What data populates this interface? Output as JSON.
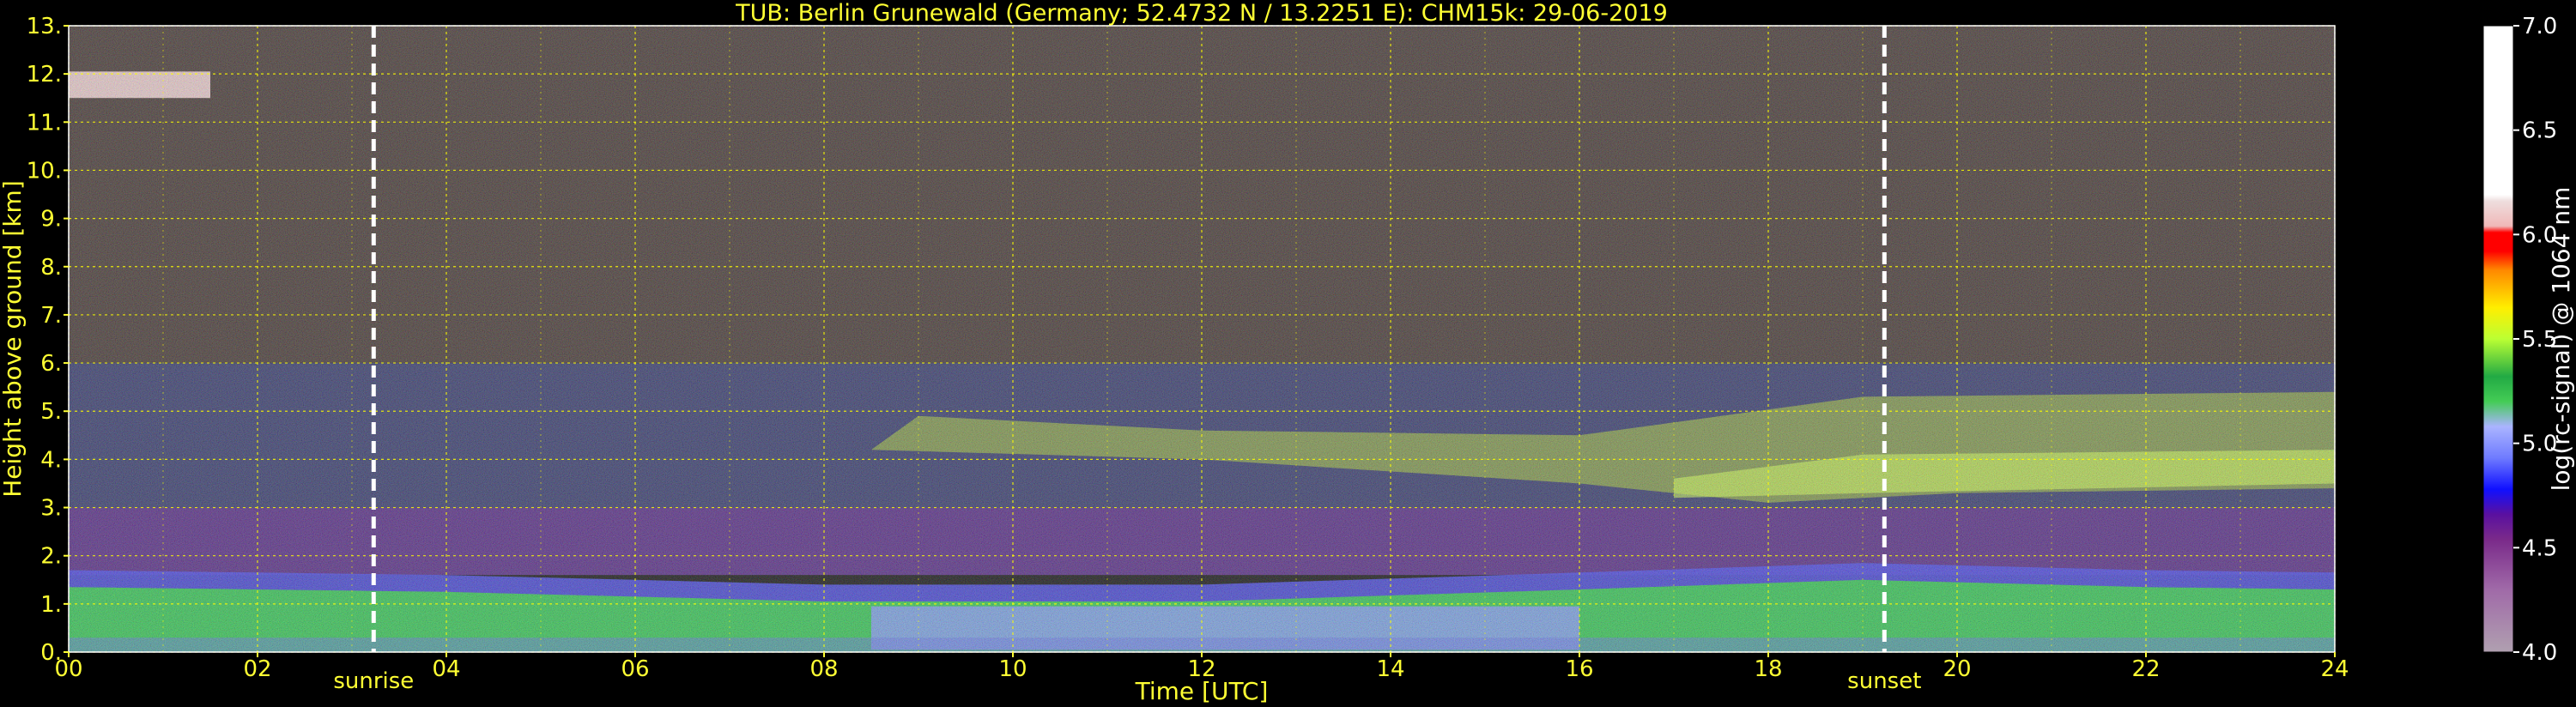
{
  "chart_data": {
    "type": "heatmap",
    "title": "TUB: Berlin Grunewald (Germany; 52.4732 N / 13.2251 E):    CHM15k: 29-06-2019",
    "xlabel": "Time [UTC]",
    "ylabel": "Height above ground [km]",
    "xlim": [
      0,
      24
    ],
    "ylim": [
      0,
      13
    ],
    "x_ticks": [
      "00",
      "02",
      "04",
      "06",
      "08",
      "10",
      "12",
      "14",
      "16",
      "18",
      "20",
      "22",
      "24"
    ],
    "y_ticks": [
      "0.",
      "1.",
      "2.",
      "3.",
      "4.",
      "5.",
      "6.",
      "7.",
      "8.",
      "9.",
      "10.",
      "11.",
      "12.",
      "13."
    ],
    "grid": true,
    "colorbar": {
      "label": "log(rc-signal) @ 1064 nm",
      "range": [
        4.0,
        7.0
      ],
      "ticks": [
        "4.0",
        "4.5",
        "5.0",
        "5.5",
        "6.0",
        "6.5",
        "7.0"
      ]
    },
    "markers": [
      {
        "label": "sunrise",
        "x": 3.23
      },
      {
        "label": "sunset",
        "x": 19.23
      }
    ],
    "layers": {
      "boundary_layer_top_km": [
        [
          0,
          1.35
        ],
        [
          4,
          1.25
        ],
        [
          8,
          1.05
        ],
        [
          12,
          1.05
        ],
        [
          16,
          1.3
        ],
        [
          19,
          1.5
        ],
        [
          22,
          1.35
        ],
        [
          24,
          1.3
        ]
      ],
      "aerosol_layer_top_km": [
        [
          9,
          4.9
        ],
        [
          12,
          4.6
        ],
        [
          16,
          4.5
        ],
        [
          19,
          5.3
        ],
        [
          24,
          5.4
        ]
      ],
      "aerosol_layer_bottom_km": [
        [
          8.5,
          4.2
        ],
        [
          12,
          4.0
        ],
        [
          16,
          3.5
        ],
        [
          18,
          3.1
        ],
        [
          20,
          3.3
        ],
        [
          24,
          3.4
        ]
      ],
      "cirrus_km": [
        [
          0,
          11.8
        ],
        [
          1.5,
          11.85
        ]
      ]
    }
  }
}
